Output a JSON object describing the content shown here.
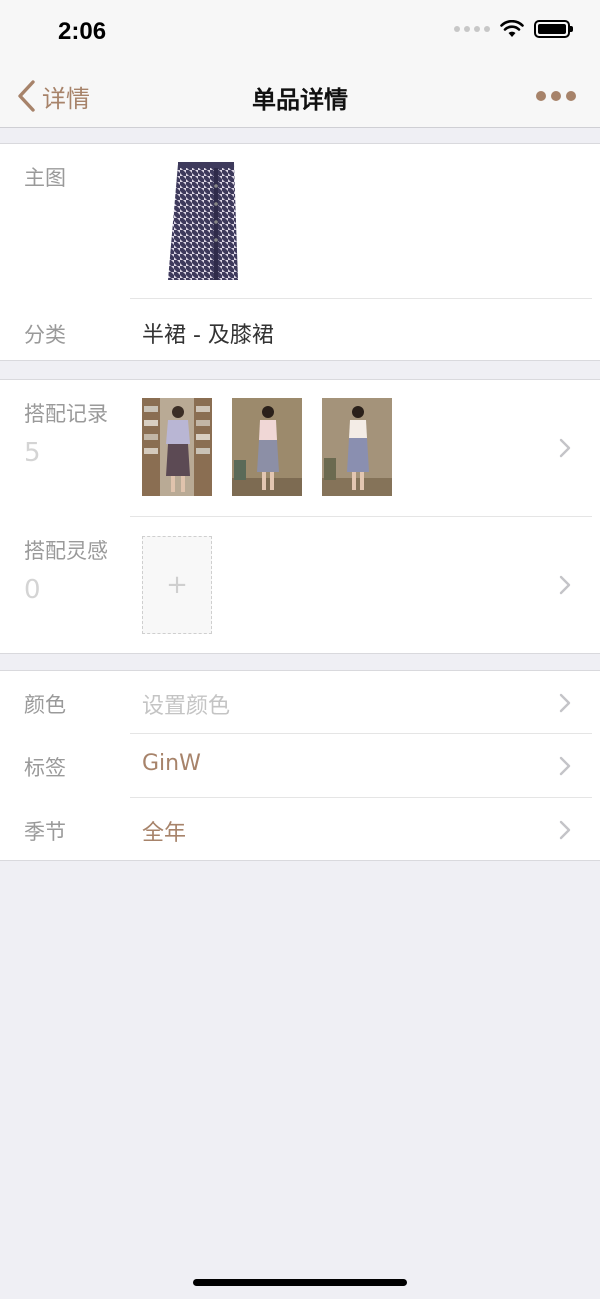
{
  "status_bar": {
    "time": "2:06"
  },
  "nav": {
    "back_label": "详情",
    "title": "单品详情",
    "more_icon": "more-dots-icon"
  },
  "main_image": {
    "label": "主图"
  },
  "category": {
    "label": "分类",
    "value": "半裙 - 及膝裙"
  },
  "outfit_records": {
    "label": "搭配记录",
    "count": "5"
  },
  "outfit_inspiration": {
    "label": "搭配灵感",
    "count": "0",
    "add_symbol": "+"
  },
  "color": {
    "label": "颜色",
    "placeholder": "设置颜色"
  },
  "tags": {
    "label": "标签",
    "value": "GinW"
  },
  "season": {
    "label": "季节",
    "value": "全年"
  },
  "colors": {
    "accent": "#a7836a",
    "background": "#efeff4"
  }
}
